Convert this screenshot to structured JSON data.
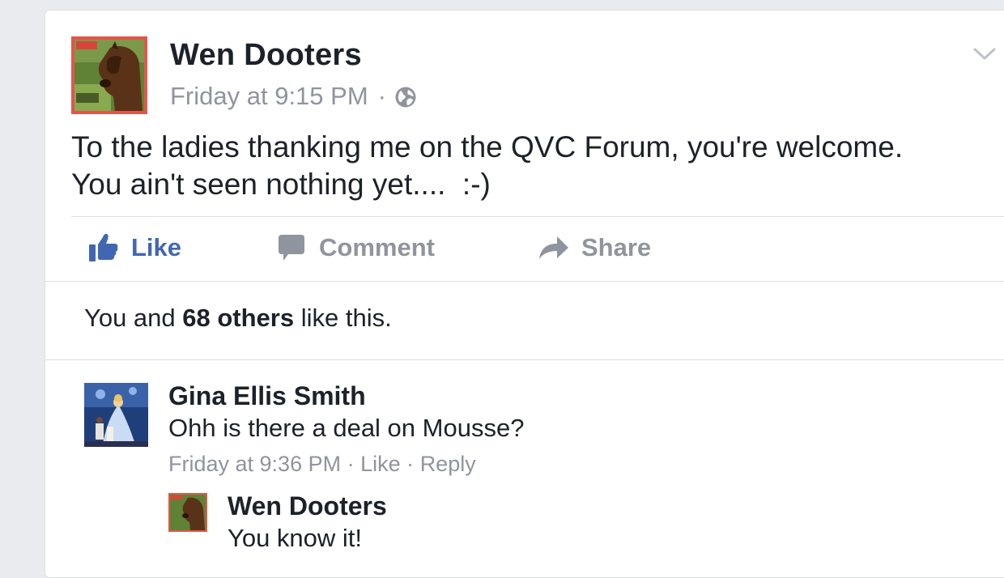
{
  "post": {
    "author": "Wen Dooters",
    "time": "Friday at 9:15 PM",
    "separator": "·",
    "privacy_icon": "globe-icon",
    "line1": "To the ladies thanking me on the QVC Forum, you're welcome.",
    "line2": "You ain't seen nothing yet....  :-)",
    "menu_icon": "chevron-down-icon"
  },
  "actions": {
    "like": "Like",
    "comment": "Comment",
    "share": "Share"
  },
  "likes": {
    "prefix": "You and ",
    "count": "68 others",
    "suffix": " like this."
  },
  "comments": [
    {
      "author": "Gina Ellis Smith",
      "text": "Ohh is there a deal on Mousse?",
      "time": "Friday at 9:36 PM",
      "sep": "·",
      "like": "Like",
      "reply": "Reply"
    }
  ],
  "reply": {
    "author": "Wen Dooters",
    "text": "You know it!"
  },
  "colors": {
    "brand_blue": "#4267b2",
    "muted": "#90949c",
    "avatar_border": "#e2564a"
  }
}
